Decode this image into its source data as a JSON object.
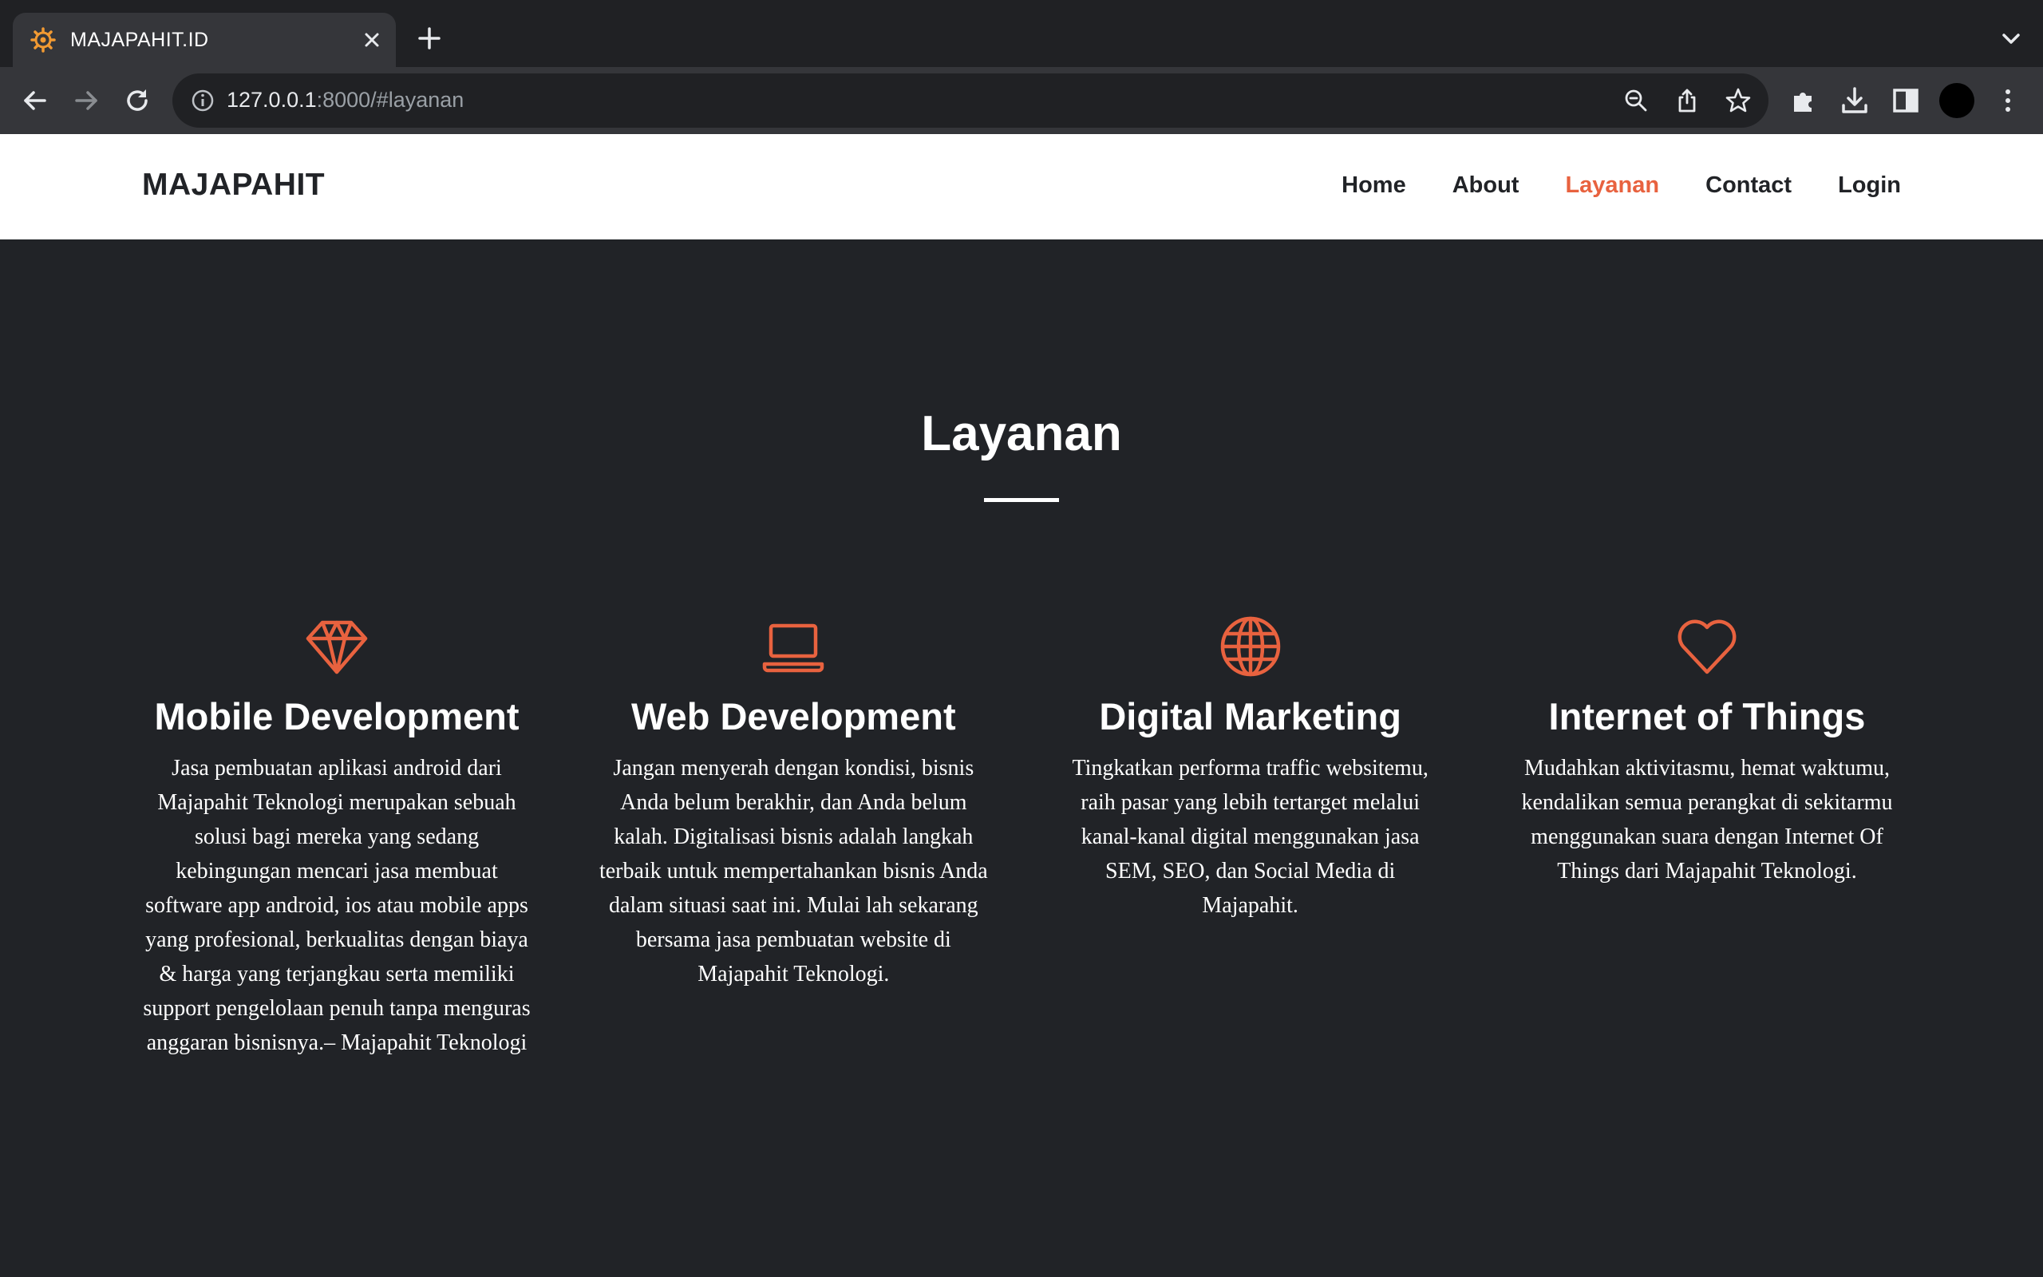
{
  "browser": {
    "tab_title": "MAJAPAHIT.ID",
    "url_host": "127.0.0.1",
    "url_rest": ":8000/#layanan"
  },
  "site": {
    "brand": "MAJAPAHIT",
    "nav": [
      {
        "label": "Home",
        "active": false
      },
      {
        "label": "About",
        "active": false
      },
      {
        "label": "Layanan",
        "active": true
      },
      {
        "label": "Contact",
        "active": false
      },
      {
        "label": "Login",
        "active": false
      }
    ]
  },
  "section": {
    "title": "Layanan",
    "accent_color": "#e8623f",
    "cards": [
      {
        "icon": "diamond-icon",
        "title": "Mobile Development",
        "text": "Jasa pembuatan aplikasi android dari Majapahit Teknologi merupakan sebuah solusi bagi mereka yang sedang kebingungan mencari jasa membuat software app android, ios atau mobile apps yang profesional, berkualitas dengan biaya & harga yang terjangkau serta memiliki support pengelolaan penuh tanpa menguras anggaran bisnisnya.– Majapahit Teknologi"
      },
      {
        "icon": "laptop-icon",
        "title": "Web Development",
        "text": "Jangan menyerah dengan kondisi, bisnis Anda belum berakhir, dan Anda belum kalah. Digitalisasi bisnis adalah langkah terbaik untuk mempertahankan bisnis Anda dalam situasi saat ini. Mulai lah sekarang bersama jasa pembuatan website di Majapahit Teknologi."
      },
      {
        "icon": "globe-icon",
        "title": "Digital Marketing",
        "text": "Tingkatkan performa traffic websitemu, raih pasar yang lebih tertarget melalui kanal-kanal digital menggunakan jasa SEM, SEO, dan Social Media di Majapahit."
      },
      {
        "icon": "heart-icon",
        "title": "Internet of Things",
        "text": "Mudahkan aktivitasmu, hemat waktumu, kendalikan semua perangkat di sekitarmu menggunakan suara dengan Internet Of Things dari Majapahit Teknologi."
      }
    ]
  }
}
